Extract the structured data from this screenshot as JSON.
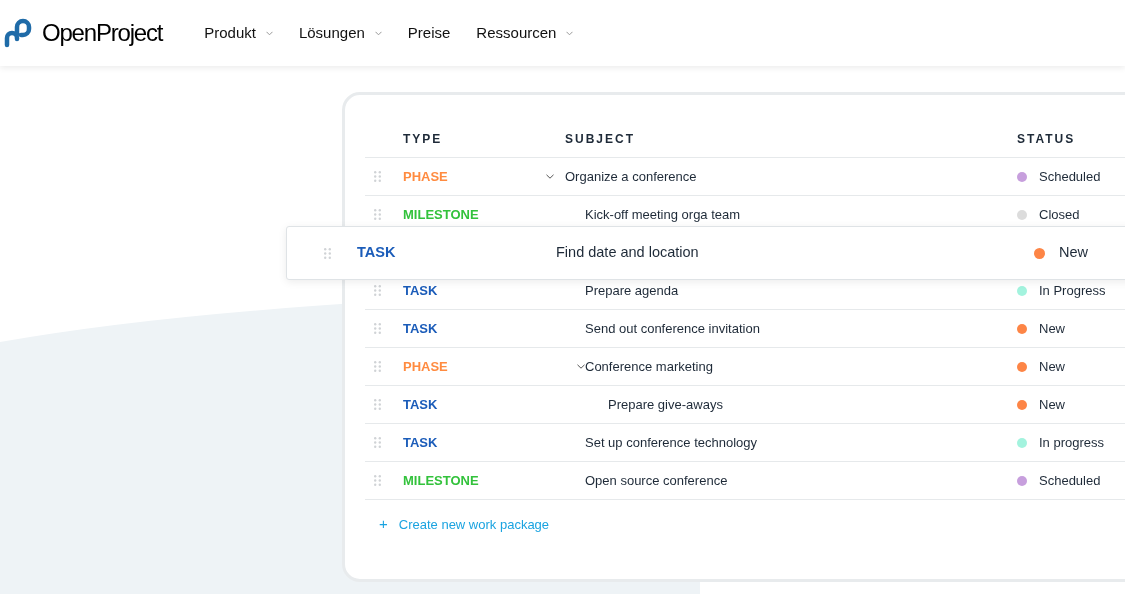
{
  "header": {
    "logo_text": "OpenProject",
    "nav": [
      {
        "label": "Produkt",
        "dropdown": true
      },
      {
        "label": "Lösungen",
        "dropdown": true
      },
      {
        "label": "Preise",
        "dropdown": false
      },
      {
        "label": "Ressourcen",
        "dropdown": true
      }
    ]
  },
  "table": {
    "columns": [
      "TYPE",
      "SUBJECT",
      "STATUS"
    ],
    "rows": [
      {
        "kind": "phase",
        "type": "PHASE",
        "subject": "Organize a conference",
        "expanded": true,
        "status": "Scheduled",
        "color": "#c79fdd",
        "children": [
          {
            "kind": "milestone",
            "type": "MILESTONE",
            "subject": "Kick-off meeting orga team",
            "status": "Closed",
            "color": "#dcdcdc",
            "dragged": false
          },
          {
            "kind": "task",
            "type": "TASK",
            "subject": "Find date and location",
            "status": "New",
            "color": "#fd8546",
            "dragged": true
          },
          {
            "kind": "task",
            "type": "TASK",
            "subject": "Prepare agenda",
            "status": "In Progress",
            "color": "#a3f3de",
            "dragged": false
          },
          {
            "kind": "task",
            "type": "TASK",
            "subject": "Send out conference invitation",
            "status": "New",
            "color": "#fd8546",
            "dragged": false
          },
          {
            "kind": "phase",
            "type": "PHASE",
            "subject": "Conference marketing",
            "expanded": true,
            "status": "New",
            "color": "#fd8546",
            "dragged": false,
            "children": [
              {
                "kind": "task",
                "type": "TASK",
                "subject": "Prepare give-aways",
                "status": "New",
                "color": "#fd8546",
                "dragged": false
              }
            ]
          },
          {
            "kind": "task",
            "type": "TASK",
            "subject": "Set up conference technology",
            "status": "In progress",
            "color": "#a3f3de",
            "dragged": false
          },
          {
            "kind": "milestone",
            "type": "MILESTONE",
            "subject": "Open source conference",
            "status": "Scheduled",
            "color": "#c79fdd",
            "dragged": false
          }
        ]
      }
    ],
    "create_link": {
      "icon": "+",
      "label": "Create new work package"
    }
  }
}
